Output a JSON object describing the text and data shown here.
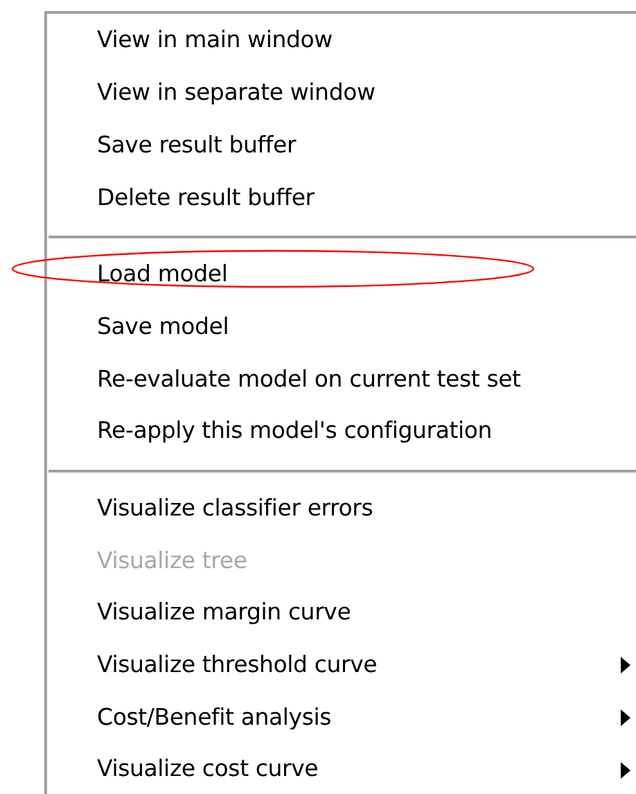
{
  "menu": {
    "items": [
      {
        "kind": "item",
        "label": "View in main window",
        "disabled": false,
        "submenu": false,
        "circled": false
      },
      {
        "kind": "item",
        "label": "View in separate window",
        "disabled": false,
        "submenu": false,
        "circled": false
      },
      {
        "kind": "item",
        "label": "Save result buffer",
        "disabled": false,
        "submenu": false,
        "circled": false
      },
      {
        "kind": "item",
        "label": "Delete result buffer",
        "disabled": false,
        "submenu": false,
        "circled": false
      },
      {
        "kind": "separator"
      },
      {
        "kind": "item",
        "label": "Load model",
        "disabled": false,
        "submenu": false,
        "circled": true
      },
      {
        "kind": "item",
        "label": "Save model",
        "disabled": false,
        "submenu": false,
        "circled": false
      },
      {
        "kind": "item",
        "label": "Re-evaluate model on current test set",
        "disabled": false,
        "submenu": false,
        "circled": false
      },
      {
        "kind": "item",
        "label": "Re-apply this model's configuration",
        "disabled": false,
        "submenu": false,
        "circled": false
      },
      {
        "kind": "separator"
      },
      {
        "kind": "item",
        "label": "Visualize classifier errors",
        "disabled": false,
        "submenu": false,
        "circled": false
      },
      {
        "kind": "item",
        "label": "Visualize tree",
        "disabled": true,
        "submenu": false,
        "circled": false
      },
      {
        "kind": "item",
        "label": "Visualize margin curve",
        "disabled": false,
        "submenu": false,
        "circled": false
      },
      {
        "kind": "item",
        "label": "Visualize threshold curve",
        "disabled": false,
        "submenu": true,
        "circled": false
      },
      {
        "kind": "item",
        "label": "Cost/Benefit analysis",
        "disabled": false,
        "submenu": true,
        "circled": false
      },
      {
        "kind": "item",
        "label": "Visualize cost curve",
        "disabled": false,
        "submenu": true,
        "circled": false
      }
    ]
  }
}
